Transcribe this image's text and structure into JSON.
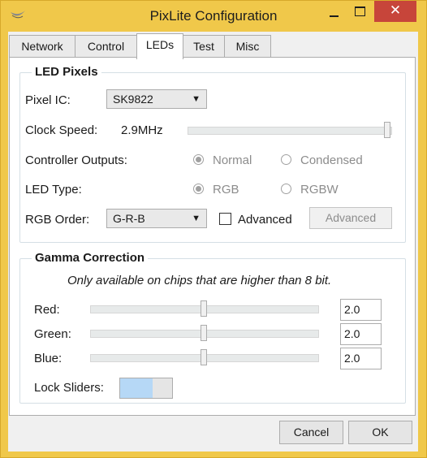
{
  "window": {
    "title": "PixLite Configuration",
    "close_glyph": "✕",
    "accent_color": "#f0c84a",
    "close_color": "#c7453a"
  },
  "tabs": [
    {
      "label": "Network"
    },
    {
      "label": "Control"
    },
    {
      "label": "LEDs",
      "active": true
    },
    {
      "label": "Test"
    },
    {
      "label": "Misc"
    }
  ],
  "led_pixels": {
    "title": "LED Pixels",
    "pixel_ic_label": "Pixel IC:",
    "pixel_ic_value": "SK9822",
    "clock_speed_label": "Clock Speed:",
    "clock_speed_value": "2.9MHz",
    "clock_speed_slider_fraction": 1.0,
    "controller_outputs_label": "Controller Outputs:",
    "controller_outputs_options": [
      "Normal",
      "Condensed"
    ],
    "controller_outputs_selected": "Normal",
    "led_type_label": "LED Type:",
    "led_type_options": [
      "RGB",
      "RGBW"
    ],
    "led_type_selected": "RGB",
    "rgb_order_label": "RGB Order:",
    "rgb_order_value": "G-R-B",
    "advanced_checkbox_label": "Advanced",
    "advanced_checkbox_checked": false,
    "advanced_button_label": "Advanced"
  },
  "gamma": {
    "title": "Gamma Correction",
    "note": "Only available on chips that are higher than 8 bit.",
    "channels": [
      {
        "label": "Red:",
        "value": "2.0",
        "slider_fraction": 0.5
      },
      {
        "label": "Green:",
        "value": "2.0",
        "slider_fraction": 0.5
      },
      {
        "label": "Blue:",
        "value": "2.0",
        "slider_fraction": 0.5
      }
    ],
    "lock_label": "Lock Sliders:",
    "lock_on": true
  },
  "footer": {
    "cancel_label": "Cancel",
    "ok_label": "OK"
  }
}
